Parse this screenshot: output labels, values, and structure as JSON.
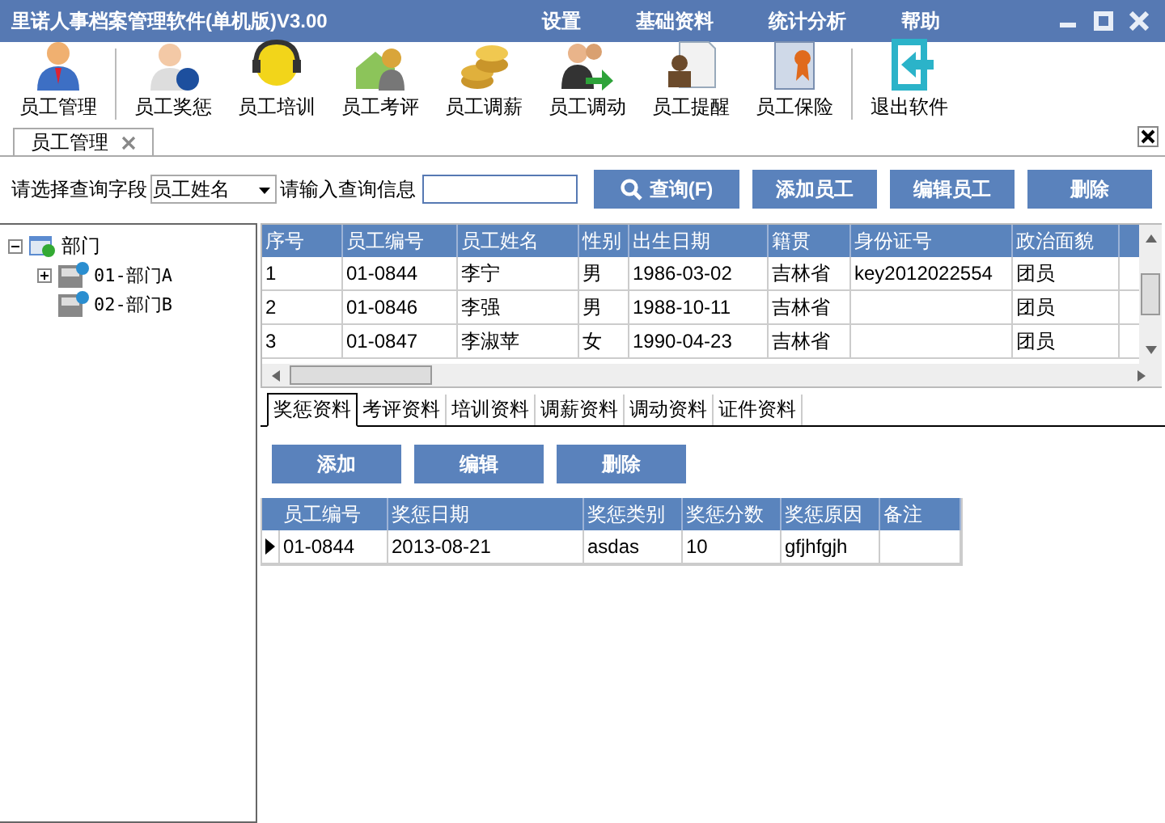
{
  "window": {
    "title": "里诺人事档案管理软件(单机版)V3.00"
  },
  "menu": [
    "设置",
    "基础资料",
    "统计分析",
    "帮助"
  ],
  "toolbar": [
    [
      "员工管理"
    ],
    [
      "员工奖惩",
      "员工培训",
      "员工考评",
      "员工调薪",
      "员工调动",
      "员工提醒",
      "员工保险"
    ],
    [
      "退出软件"
    ]
  ],
  "doc_tabs": [
    {
      "label": "员工管理",
      "selected": true
    }
  ],
  "query": {
    "field_label": "请选择查询字段",
    "field_value": "员工姓名",
    "input_label": "请输入查询信息",
    "buttons": [
      {
        "label": "查询(F)",
        "kind": "search"
      },
      {
        "label": "添加员工",
        "kind": "plain"
      },
      {
        "label": "编辑员工",
        "kind": "plain"
      },
      {
        "label": "删除",
        "kind": "plain"
      }
    ]
  },
  "tree": {
    "label": "部门",
    "expanded": true,
    "children": [
      {
        "label": "01-部门A",
        "expanded": false
      },
      {
        "label": "02-部门B"
      }
    ]
  },
  "grid": {
    "columns": [
      "序号",
      "员工编号",
      "员工姓名",
      "性别",
      "出生日期",
      "籍贯",
      "身份证号",
      "政治面貌"
    ],
    "rows": [
      [
        "1",
        "01-0844",
        "李宁",
        "男",
        "1986-03-02",
        "吉林省",
        "key2012022554",
        "团员"
      ],
      [
        "2",
        "01-0846",
        "李强",
        "男",
        "1988-10-11",
        "吉林省",
        "",
        "团员"
      ],
      [
        "3",
        "01-0847",
        "李淑苹",
        "女",
        "1990-04-23",
        "吉林省",
        "",
        "团员"
      ]
    ]
  },
  "sub_tabs": [
    {
      "label": "奖惩资料",
      "selected": true
    },
    {
      "label": "考评资料",
      "selected": false
    },
    {
      "label": "培训资料",
      "selected": false
    },
    {
      "label": "调薪资料",
      "selected": false
    },
    {
      "label": "调动资料",
      "selected": false
    },
    {
      "label": "证件资料",
      "selected": false
    }
  ],
  "sub_buttons": [
    "添加",
    "编辑",
    "删除"
  ],
  "sub_grid": {
    "columns": [
      "员工编号",
      "奖惩日期",
      "奖惩类别",
      "奖惩分数",
      "奖惩原因",
      "备注"
    ],
    "rows": [
      {
        "current": true,
        "cells": [
          "01-0844",
          "2013-08-21",
          "asdas",
          "10",
          "gfjhfgjh",
          ""
        ]
      }
    ]
  }
}
